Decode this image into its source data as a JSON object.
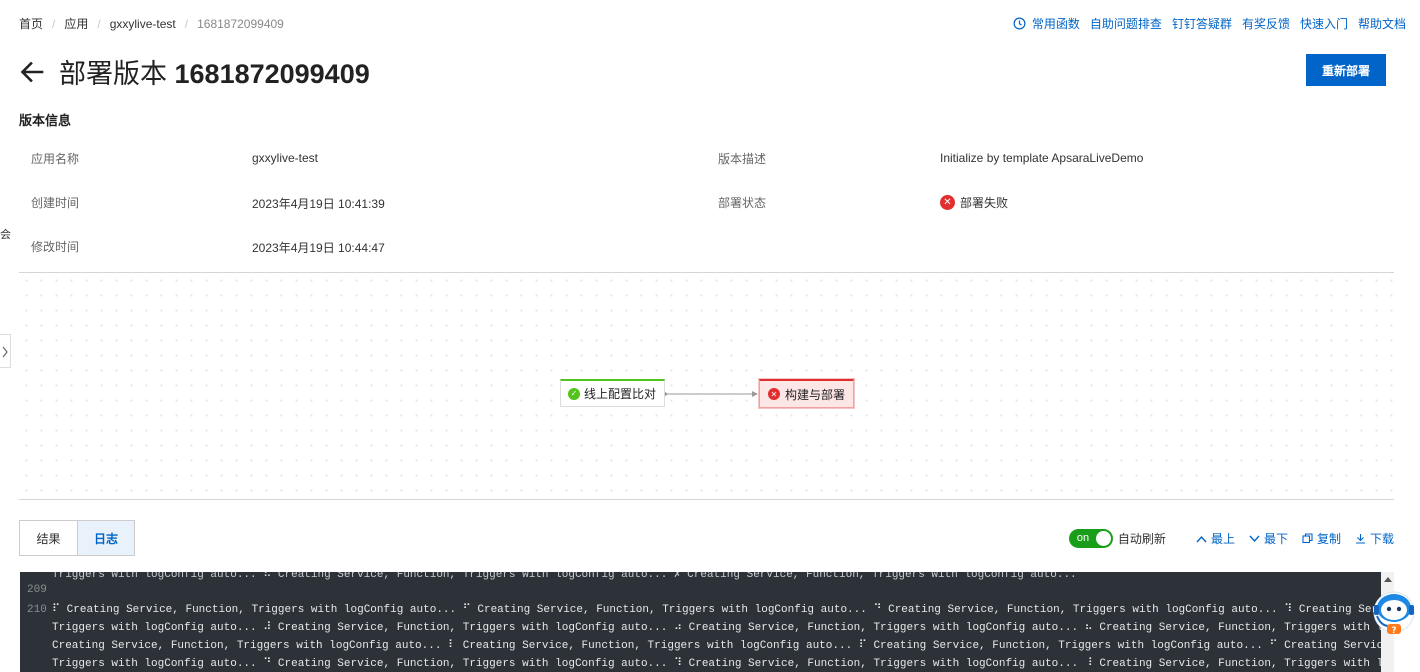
{
  "breadcrumb": {
    "items": [
      "首页",
      "应用",
      "gxxylive-test"
    ],
    "current": "1681872099409",
    "separator": "/"
  },
  "top_links": [
    "常用函数",
    "自助问题排查",
    "钉钉答疑群",
    "有奖反馈",
    "快速入门",
    "帮助文档"
  ],
  "header": {
    "title_prefix": "部署版本",
    "title_version": "1681872099409",
    "redeploy_label": "重新部署"
  },
  "version_info": {
    "section_title": "版本信息",
    "app_name_label": "应用名称",
    "app_name_value": "gxxylive-test",
    "desc_label": "版本描述",
    "desc_value": "Initialize by template ApsaraLiveDemo",
    "created_label": "创建时间",
    "created_value": "2023年4月19日 10:41:39",
    "status_label": "部署状态",
    "status_value": "部署失败",
    "modified_label": "修改时间",
    "modified_value": "2023年4月19日 10:44:47"
  },
  "side_glyph": "会",
  "pipeline": {
    "step1_label": "线上配置比对",
    "step2_label": "构建与部署"
  },
  "tabs": [
    "结果",
    "日志"
  ],
  "log_tools": {
    "switch_text": "on",
    "auto_refresh": "自动刷新",
    "top": "最上",
    "bottom": "最下",
    "copy": "复制",
    "download": "下载"
  },
  "log": {
    "line_top": "Triggers with logConfig auto... ⠧ Creating Service, Function, Triggers with logConfig auto... ✗ Creating Service, Function, Triggers with logConfig auto...",
    "line_209_num": "209",
    "line_210_num": "210",
    "line_210a": "⠏ Creating Service, Function, Triggers with logConfig auto... ⠋ Creating Service, Function, Triggers with logConfig auto... ⠙ Creating Service, Function, Triggers with logConfig auto... ⠹ Creating Service, Function,",
    "line_210b": "Triggers with logConfig auto... ⠼ Creating Service, Function, Triggers with logConfig auto... ⠴ Creating Service, Function, Triggers with logConfig auto... ⠦ Creating Service, Function, Triggers with logConfig auto... ⠧",
    "line_210c": "Creating Service, Function, Triggers with logConfig auto... ⠇ Creating Service, Function, Triggers with logConfig auto... ⠏ Creating Service, Function, Triggers with logConfig auto... ⠋ Creating Service, Function,",
    "line_210d": "Triggers with logConfig auto... ⠙ Creating Service, Function, Triggers with logConfig auto... ⠹ Creating Service, Function, Triggers with logConfig auto... ⠸ Creating Service, Function, Triggers with logConfig auto... ⠼"
  },
  "colors": {
    "primary": "#0064c8",
    "success": "#52c41a",
    "danger": "#e12e2e",
    "log_bg": "#2c3238"
  }
}
